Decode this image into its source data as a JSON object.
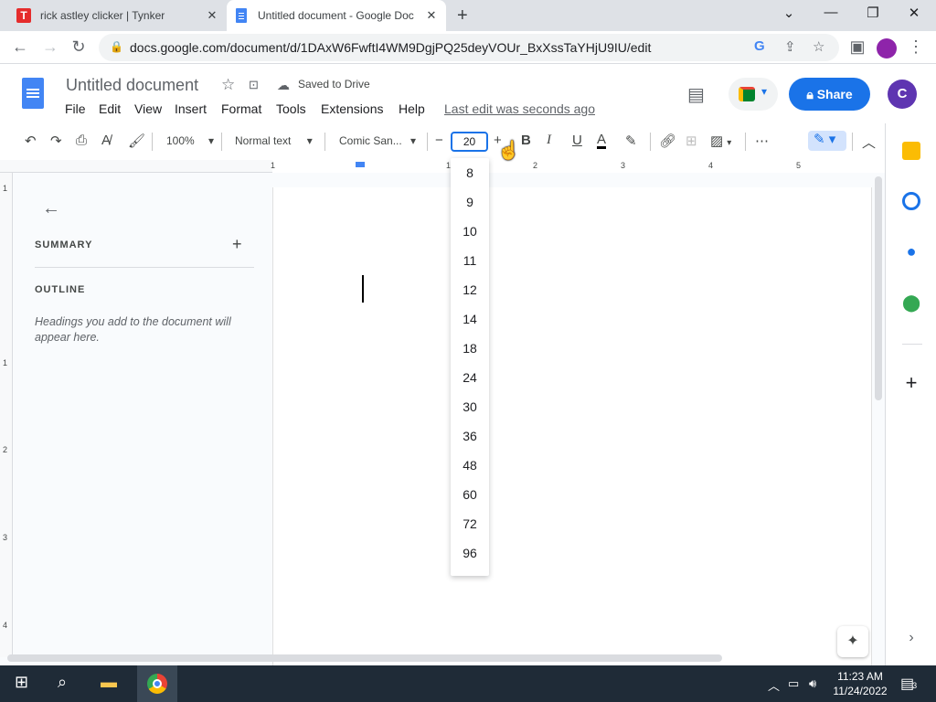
{
  "browser": {
    "tabs": [
      {
        "title": "rick astley clicker | Tynker",
        "favicon": "T"
      },
      {
        "title": "Untitled document - Google Doc",
        "active": true
      }
    ],
    "url": "docs.google.com/document/d/1DAxW6FwftI4WM9DgjPQ25deyVOUr_BxXssTaYHjU9IU/edit"
  },
  "docs": {
    "title": "Untitled document",
    "saved_status": "Saved to Drive",
    "menus": [
      "File",
      "Edit",
      "View",
      "Insert",
      "Format",
      "Tools",
      "Extensions",
      "Help"
    ],
    "last_edit": "Last edit was seconds ago",
    "share_label": "Share",
    "avatar_letter": "C"
  },
  "toolbar": {
    "zoom": "100%",
    "style": "Normal text",
    "font": "Comic San...",
    "font_size": "20",
    "minus": "−",
    "plus": "+"
  },
  "ruler": {
    "numbers": [
      "1",
      "1",
      "2",
      "3",
      "4",
      "5"
    ]
  },
  "vruler": {
    "numbers": [
      "1",
      "1",
      "2",
      "3",
      "4"
    ]
  },
  "outline": {
    "summary": "SUMMARY",
    "outline": "OUTLINE",
    "hint": "Headings you add to the document will appear here."
  },
  "font_sizes": [
    "8",
    "9",
    "10",
    "11",
    "12",
    "14",
    "18",
    "24",
    "30",
    "36",
    "48",
    "60",
    "72",
    "96"
  ],
  "taskbar": {
    "time": "11:23 AM",
    "date": "11/24/2022",
    "notifications": "3"
  },
  "colors": {
    "accent": "#1a73e8",
    "docs_blue": "#4285f4",
    "avatar": "#5e35b1",
    "taskbar": "#1f2b37"
  }
}
